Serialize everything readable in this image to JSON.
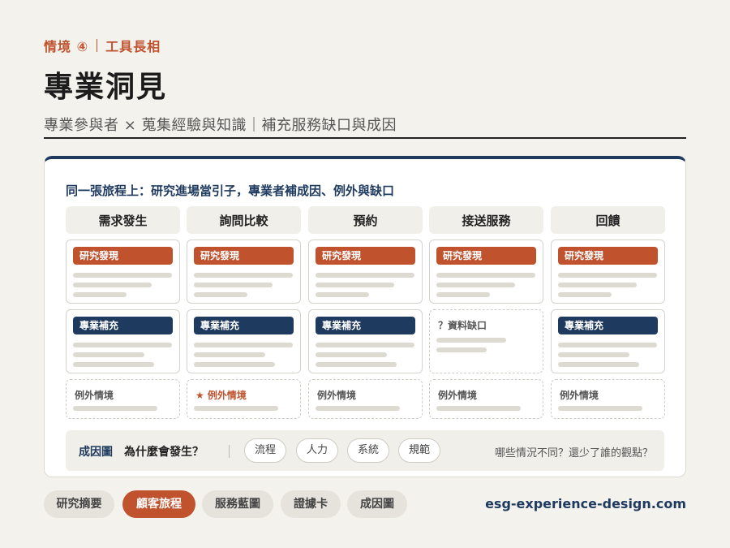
{
  "header": {
    "kicker_scenario": "情境 ④",
    "kicker_topic": "工具長相",
    "title": "專業洞見",
    "subtitle": "專業參與者 × 蒐集經驗與知識｜補充服務缺口與成因"
  },
  "card": {
    "heading": "同一張旅程上：研究進場當引子，專業者補成因、例外與缺口",
    "stages": [
      "需求發生",
      "詢問比較",
      "預約",
      "接送服務",
      "回饋"
    ],
    "research_tag": "研究發現",
    "expert_tag": "專業補充",
    "gap_label": "？資料缺口",
    "exception_label": "例外情境",
    "exception_highlight_label": "★ 例外情境",
    "expert_row": [
      "expert",
      "expert",
      "expert",
      "gap",
      "expert"
    ],
    "exception_row_highlight": [
      false,
      true,
      false,
      false,
      false
    ]
  },
  "strip": {
    "label": "成因圖",
    "question": "為什麼會發生？",
    "chips": [
      "流程",
      "人力",
      "系統",
      "規範"
    ],
    "prompt": "哪些情況不同？還少了誰的觀點？"
  },
  "nav": {
    "items": [
      "研究摘要",
      "顧客旅程",
      "服務藍圖",
      "證據卡",
      "成因圖"
    ],
    "active_index": 1
  },
  "footer": {
    "site": "esg-experience-design.com"
  },
  "colors": {
    "accent": "#c0522e",
    "navy": "#1f3a5f",
    "bg": "#f4f2ed"
  }
}
